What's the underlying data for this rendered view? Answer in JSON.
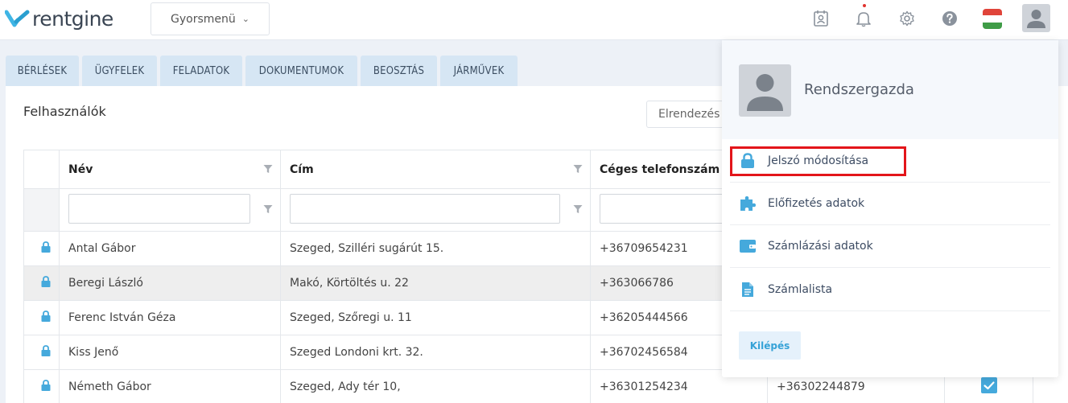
{
  "brand": {
    "name": "rentgine",
    "accent": "#3fb5e5"
  },
  "topbar": {
    "quickmenu_label": "Gyorsmenü",
    "icons": [
      "contact-card-icon",
      "bell-icon",
      "gear-icon",
      "help-icon",
      "flag-hu-icon",
      "avatar-icon"
    ]
  },
  "tabs": [
    "BÉRLÉSEK",
    "ÜGYFELEK",
    "FELADATOK",
    "DOKUMENTUMOK",
    "BEOSZTÁS",
    "JÁRMŰVEK"
  ],
  "panel": {
    "title": "Felhasználók",
    "layout_button": "Elrendezés"
  },
  "table": {
    "columns": [
      "Név",
      "Cím",
      "Céges telefonszám"
    ],
    "rows": [
      {
        "name": "Antal Gábor",
        "address": "Szeged, Szilléri sugárút 15.",
        "phone": "+36709654231",
        "phone2": ""
      },
      {
        "name": "Beregi László",
        "address": "Makó, Körtöltés u. 22",
        "phone": "+363066786",
        "phone2": ""
      },
      {
        "name": "Ferenc István Géza",
        "address": "Szeged, Szőregi u. 11",
        "phone": "+36205444566",
        "phone2": ""
      },
      {
        "name": "Kiss Jenő",
        "address": "Szeged Londoni krt. 32.",
        "phone": "+36702456584",
        "phone2": ""
      },
      {
        "name": "Németh Gábor",
        "address": "Szeged, Ady tér 10,",
        "phone": "+36301254234",
        "phone2": "+36302244879"
      }
    ]
  },
  "user_menu": {
    "user_name": "Rendszergazda",
    "items": [
      {
        "label": "Jelszó módosítása",
        "icon": "lock-icon"
      },
      {
        "label": "Előfizetés adatok",
        "icon": "puzzle-icon"
      },
      {
        "label": "Számlázási adatok",
        "icon": "wallet-icon"
      },
      {
        "label": "Számlalista",
        "icon": "document-icon"
      }
    ],
    "logout_label": "Kilépés"
  }
}
